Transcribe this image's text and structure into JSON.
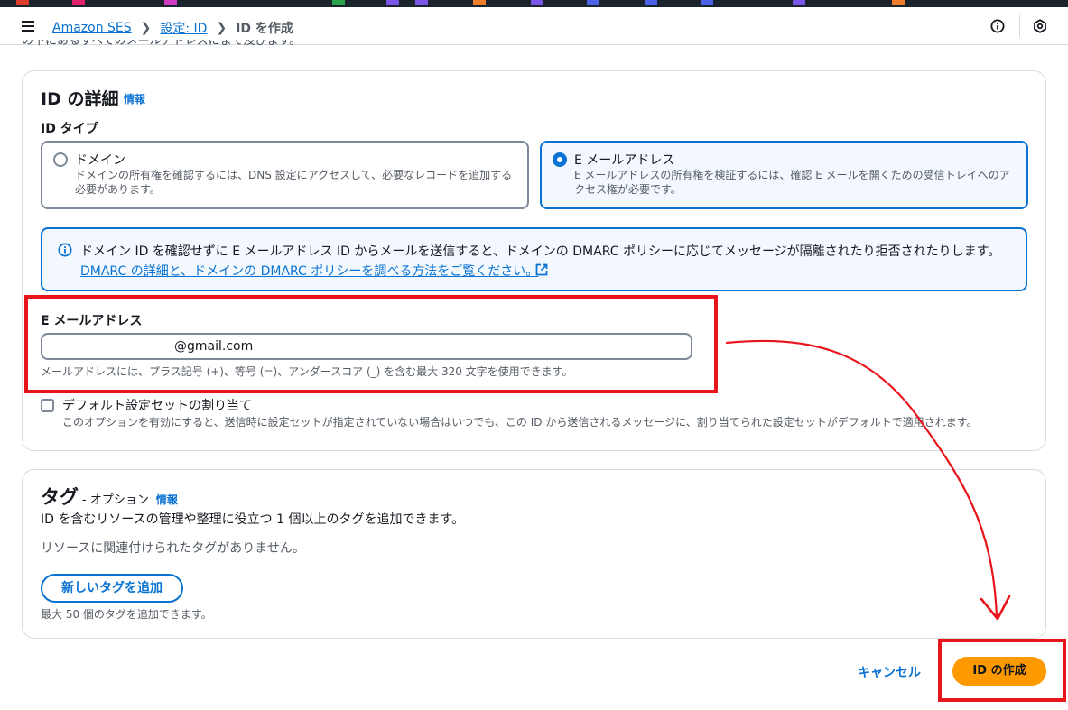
{
  "topbar": {
    "background": "#1b232d",
    "mark_colors": [
      "#dd3b2b",
      "#e0206c",
      "#d03bc4",
      "#2aa14b",
      "#7b55e6",
      "#7b55e6",
      "#ef7e2a",
      "#7b55e6",
      "#4c63e7",
      "#4c63e7",
      "#4c63e7",
      "#7b55e6",
      "#ef7e2a"
    ]
  },
  "header": {
    "menu_icon": "hamburger-icon",
    "breadcrumb": {
      "service": "Amazon SES",
      "settings": "設定: ID",
      "current": "ID を作成"
    },
    "right_icons": [
      "info-circle-icon",
      "settings-hexagon-icon"
    ]
  },
  "clipped_text": "の下にあるすべてのメールアドレスにまで及びます。",
  "details": {
    "title": "ID の詳細",
    "info": "情報",
    "type_label": "ID タイプ",
    "options": [
      {
        "title": "ドメイン",
        "desc_line1": "ドメインの所有権を確認するには、DNS 設定にアクセスして、必要なレコードを追加する",
        "desc_line2": "必要があります。",
        "selected": false
      },
      {
        "title": "E メールアドレス",
        "desc_line1": "E メールアドレスの所有権を検証するには、確認 E メールを開くための受信トレイへのア",
        "desc_line2": "クセス権が必要です。",
        "selected": true
      }
    ],
    "alert": {
      "text": "ドメイン ID を確認せずに E メールアドレス ID からメールを送信すると、ドメインの DMARC ポリシーに応じてメッセージが隔離されたり拒否されたりします。",
      "link": "DMARC の詳細と、ドメインの DMARC ポリシーを調べる方法をご覧ください。"
    },
    "email": {
      "label": "E メールアドレス",
      "value": "@gmail.com",
      "constraint": "メールアドレスには、プラス記号 (+)、等号 (=)、アンダースコア (_) を含む最大 320 文字を使用できます。"
    },
    "default_config": {
      "label": "デフォルト設定セットの割り当て",
      "desc": "このオプションを有効にすると、送信時に設定セットが指定されていない場合はいつでも、この ID から送信されるメッセージに、割り当てられた設定セットがデフォルトで適用されます。",
      "checked": false
    }
  },
  "tags": {
    "title": "タグ",
    "optional": "- オプション",
    "info": "情報",
    "desc": "ID を含むリソースの管理や整理に役立つ 1 個以上のタグを追加できます。",
    "empty": "リソースに関連付けられたタグがありません。",
    "add_button": "新しいタグを追加",
    "limit": "最大 50 個のタグを追加できます。"
  },
  "footer": {
    "cancel": "キャンセル",
    "create": "ID の作成"
  },
  "colors": {
    "link": "#0972d3",
    "primary_button": "#ff9900",
    "annotation": "#e8141c"
  }
}
